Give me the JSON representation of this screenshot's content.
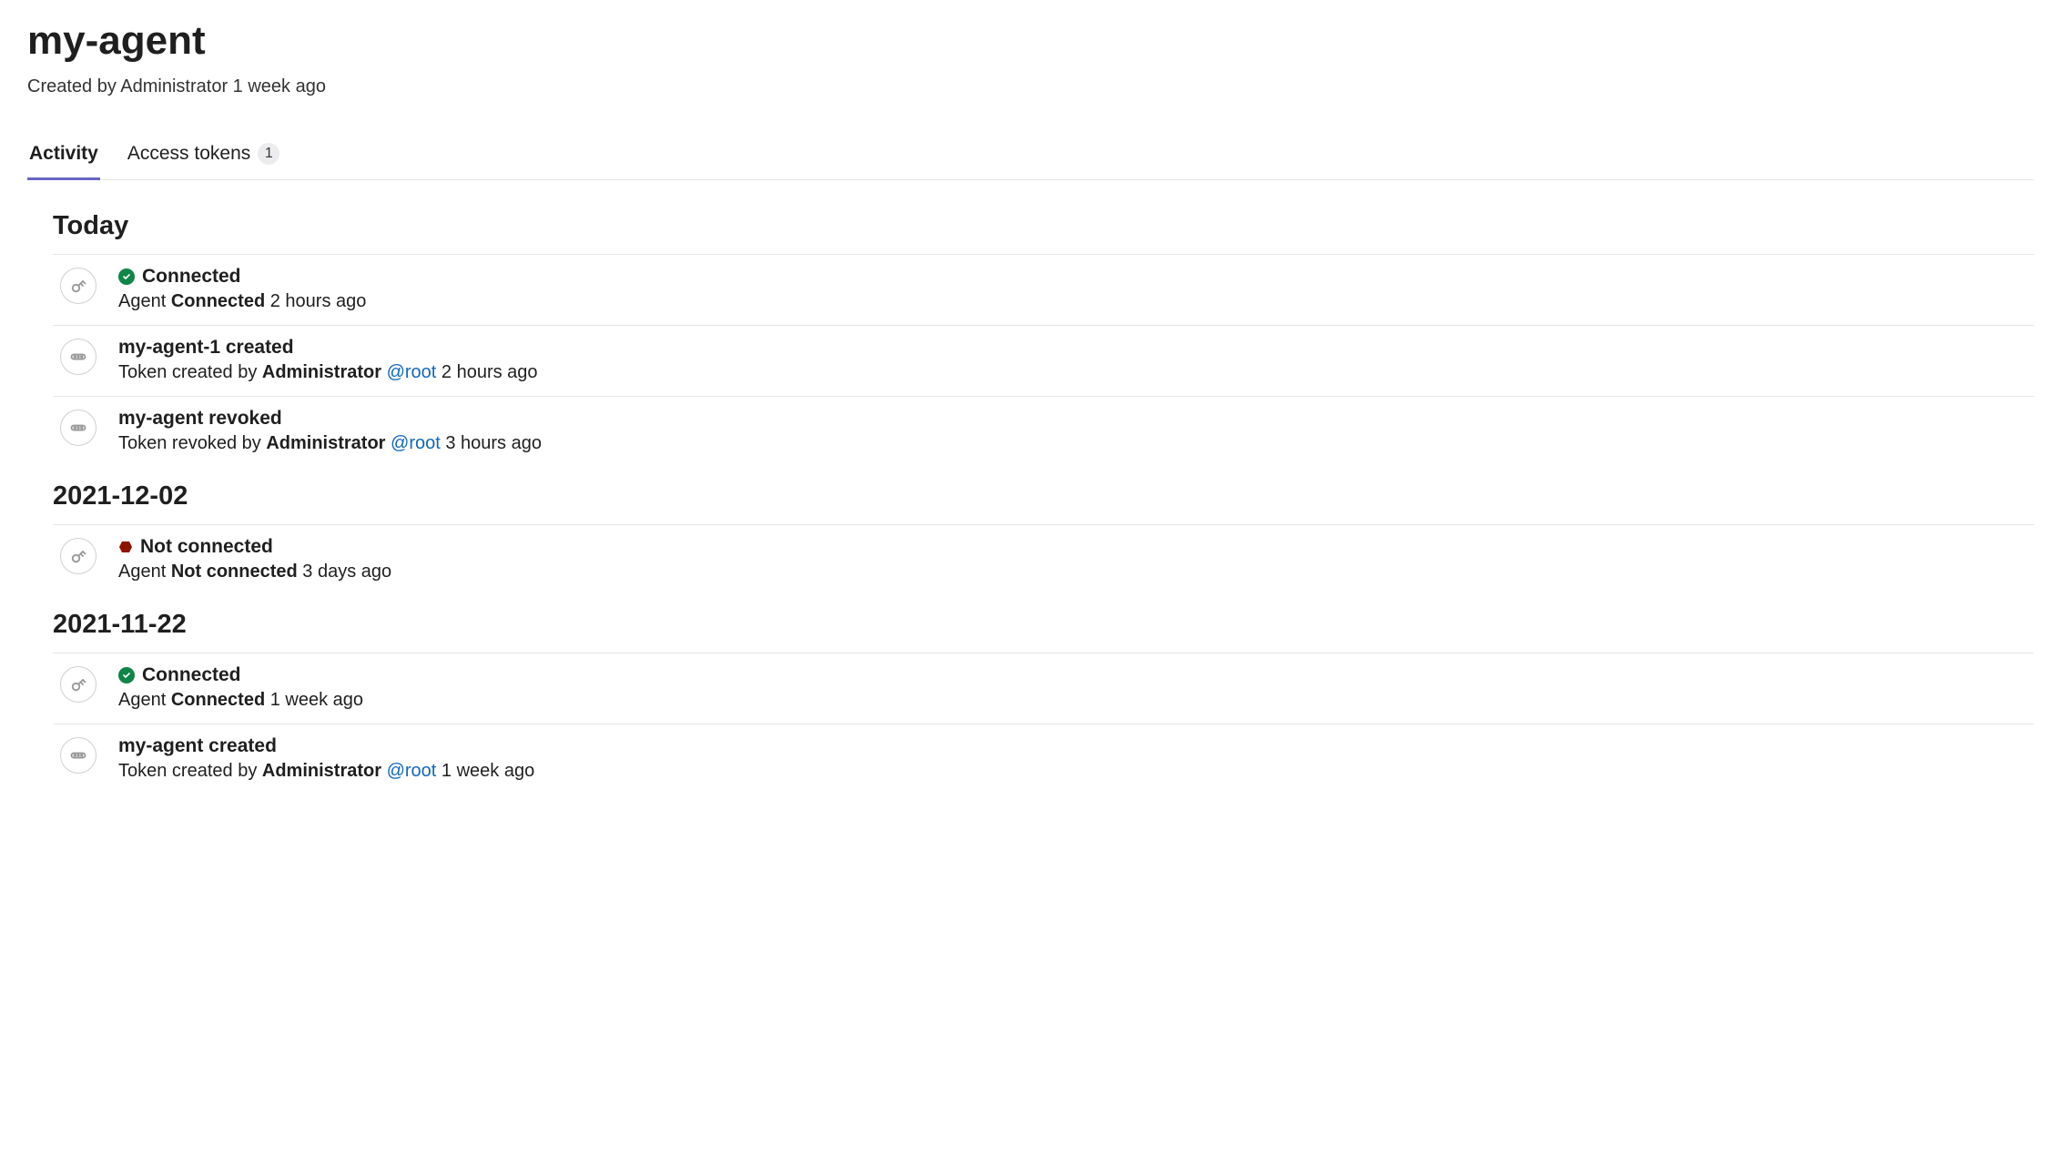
{
  "header": {
    "title": "my-agent",
    "created_prefix": "Created by",
    "created_by": "Administrator",
    "created_time": "1 week ago"
  },
  "tabs": {
    "activity": "Activity",
    "access_tokens": "Access tokens",
    "access_tokens_count": "1"
  },
  "sections": [
    {
      "heading": "Today",
      "events": [
        {
          "icon": "plug",
          "status": "green",
          "title": "Connected",
          "sub_prefix": "Agent",
          "sub_bold": "Connected",
          "sub_time": "2 hours ago"
        },
        {
          "icon": "token",
          "title": "my-agent-1 created",
          "sub_prefix": "Token created by",
          "sub_bold": "Administrator",
          "sub_link": "@root",
          "sub_time": "2 hours ago"
        },
        {
          "icon": "token",
          "title": "my-agent revoked",
          "sub_prefix": "Token revoked by",
          "sub_bold": "Administrator",
          "sub_link": "@root",
          "sub_time": "3 hours ago"
        }
      ]
    },
    {
      "heading": "2021-12-02",
      "events": [
        {
          "icon": "plug",
          "status": "red",
          "title": "Not connected",
          "sub_prefix": "Agent",
          "sub_bold": "Not connected",
          "sub_time": "3 days ago"
        }
      ]
    },
    {
      "heading": "2021-11-22",
      "events": [
        {
          "icon": "plug",
          "status": "green",
          "title": "Connected",
          "sub_prefix": "Agent",
          "sub_bold": "Connected",
          "sub_time": "1 week ago"
        },
        {
          "icon": "token",
          "title": "my-agent created",
          "sub_prefix": "Token created by",
          "sub_bold": "Administrator",
          "sub_link": "@root",
          "sub_time": "1 week ago"
        }
      ]
    }
  ]
}
